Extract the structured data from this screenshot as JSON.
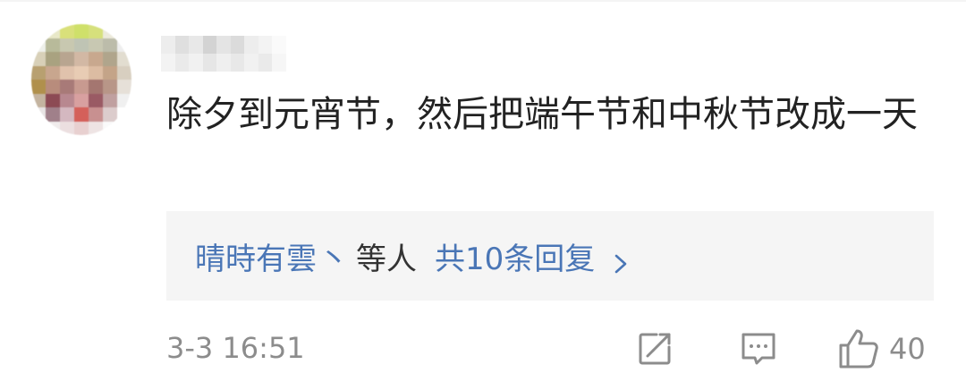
{
  "comment": {
    "text": "除夕到元宵节，然后把端午节和中秋节改成一天"
  },
  "replies": {
    "users": "晴時有雲",
    "separator": "丶",
    "suffix": "等人",
    "count_label": "共10条回复"
  },
  "footer": {
    "timestamp": "3-3 16:51",
    "like_count": "40"
  },
  "icons": {
    "share": "edit-share-icon",
    "comment": "comment-bubble-icon",
    "like": "thumbs-up-icon",
    "chevron": "chevron-right-icon"
  },
  "colors": {
    "link": "#4a76b6",
    "text": "#222222",
    "muted": "#8c8c8c",
    "reply_bg": "#f5f5f5"
  }
}
